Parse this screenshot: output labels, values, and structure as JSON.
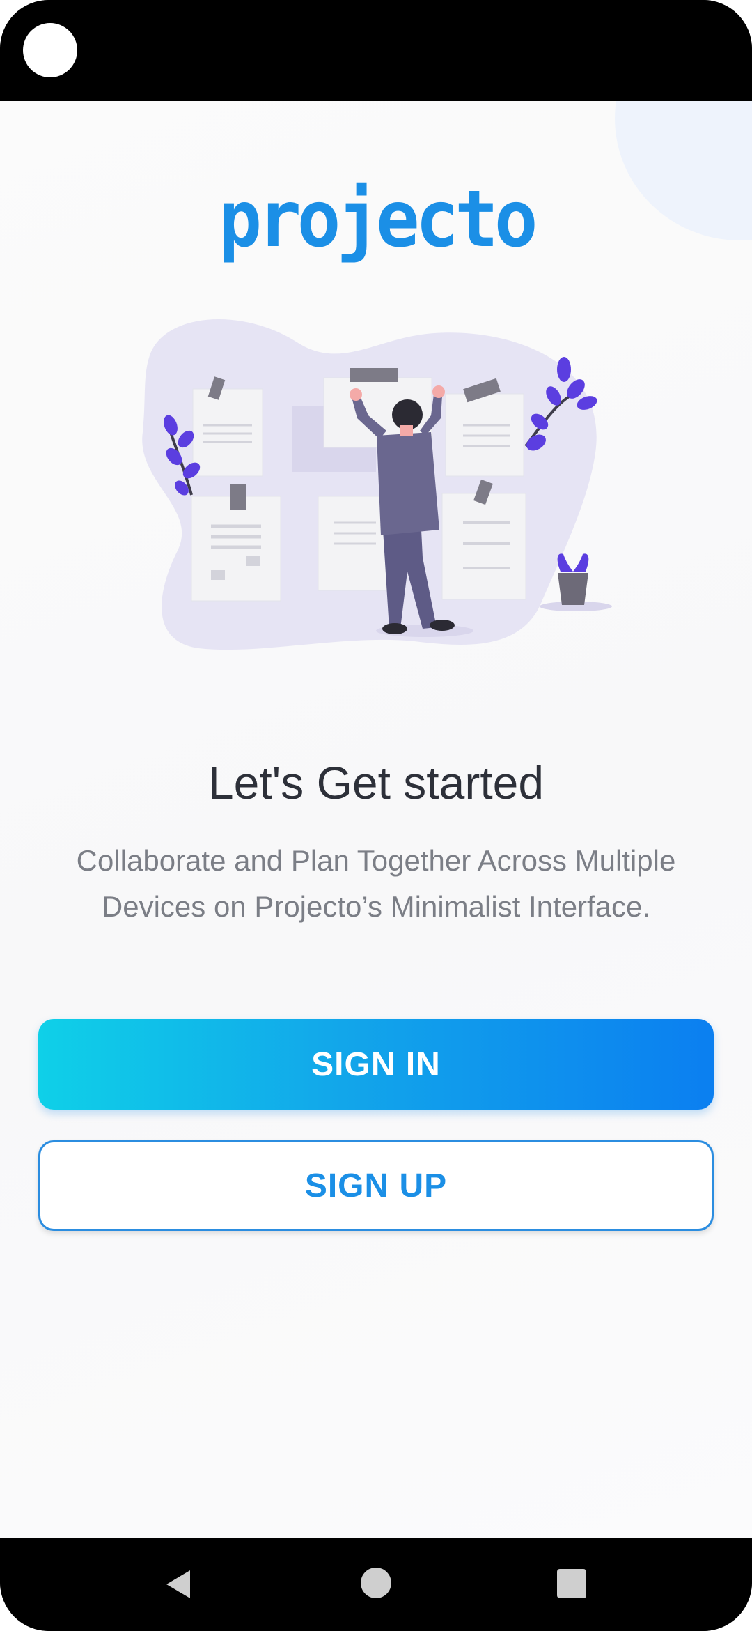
{
  "app": {
    "logo_text": "projecto",
    "brand_color": "#1b8fe6"
  },
  "onboarding": {
    "headline": "Let's Get started",
    "subtitle_line1": "Collaborate and Plan Together Across Multiple",
    "subtitle_line2": "Devices on Projecto’s Minimalist Interface."
  },
  "actions": {
    "sign_in_label": "SIGN IN",
    "sign_up_label": "SIGN UP",
    "sign_in_gradient": [
      "#0fd0e8",
      "#0b7ff0"
    ],
    "sign_up_border": "#2b8de0"
  },
  "illustration": {
    "name": "man-pinning-notes-illustration",
    "accent_color": "#5b3ee0",
    "blob_color": "#e6e4f4"
  },
  "navigation": {
    "back_icon": "triangle-back-icon",
    "home_icon": "circle-home-icon",
    "recents_icon": "square-recents-icon"
  }
}
